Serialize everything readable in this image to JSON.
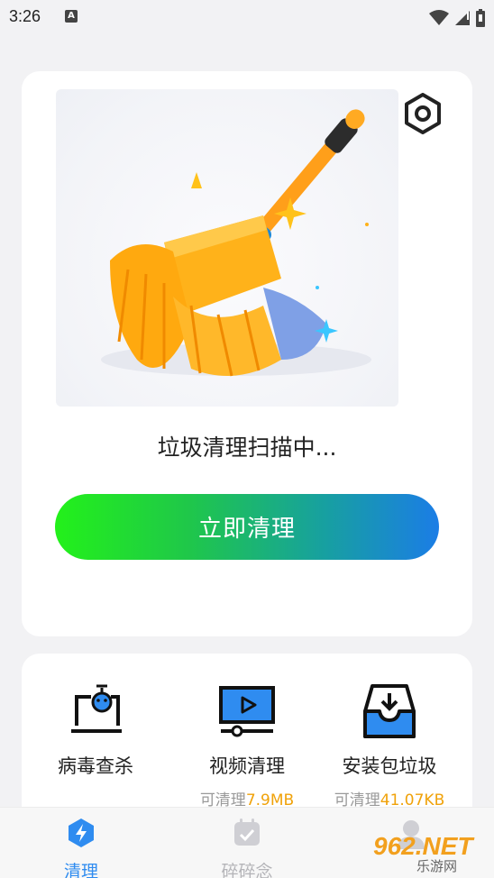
{
  "status_bar": {
    "time": "3:26",
    "notification_letter": "A"
  },
  "main_card": {
    "scan_status": "垃圾清理扫描中...",
    "clean_button_label": "立即清理"
  },
  "tools": [
    {
      "label": "病毒查杀",
      "sub_prefix": "",
      "sub_value": ""
    },
    {
      "label": "视频清理",
      "sub_prefix": "可清理",
      "sub_value": "7.9MB"
    },
    {
      "label": "安装包垃圾",
      "sub_prefix": "可清理",
      "sub_value": "41.07KB"
    }
  ],
  "tabs": [
    {
      "label": "清理",
      "active": true
    },
    {
      "label": "碎碎念",
      "active": false
    }
  ],
  "watermark": {
    "brand": "962.NET",
    "subtitle": "乐游网"
  },
  "colors": {
    "accent_blue": "#2f8cf0",
    "accent_orange": "#f0a20a",
    "gradient_start": "#23f11a",
    "gradient_end": "#1b7de6"
  }
}
